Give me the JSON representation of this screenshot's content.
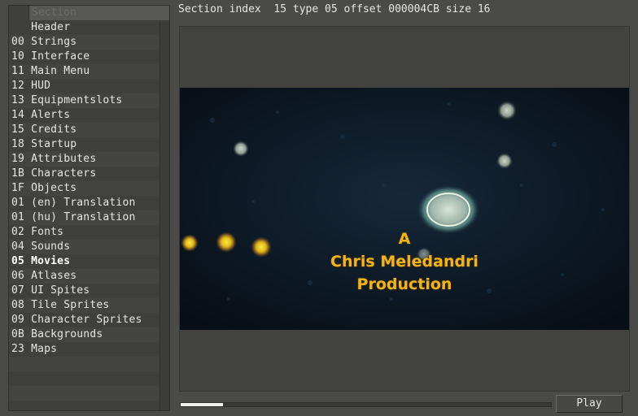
{
  "info": {
    "text": "Section index  15 type 05 offset 000004CB size 16"
  },
  "section_list": {
    "column_header": "Section",
    "selected_index": 16,
    "items": [
      {
        "label": "   Header"
      },
      {
        "label": "00 Strings"
      },
      {
        "label": "10 Interface"
      },
      {
        "label": "11 Main Menu"
      },
      {
        "label": "12 HUD"
      },
      {
        "label": "13 Equipmentslots"
      },
      {
        "label": "14 Alerts"
      },
      {
        "label": "15 Credits"
      },
      {
        "label": "18 Startup"
      },
      {
        "label": "19 Attributes"
      },
      {
        "label": "1B Characters"
      },
      {
        "label": "1F Objects"
      },
      {
        "label": "01 (en) Translation"
      },
      {
        "label": "01 (hu) Translation"
      },
      {
        "label": "02 Fonts"
      },
      {
        "label": "04 Sounds"
      },
      {
        "label": "05 Movies"
      },
      {
        "label": "06 Atlases"
      },
      {
        "label": "07 UI Spites"
      },
      {
        "label": "08 Tile Sprites"
      },
      {
        "label": "09 Character Sprites"
      },
      {
        "label": "0B Backgrounds"
      },
      {
        "label": "23 Maps"
      }
    ]
  },
  "video": {
    "credit_lines": [
      "A",
      "Chris Meledandri",
      "Production"
    ],
    "progress": 0.115
  },
  "play_button": {
    "label": "Play"
  },
  "colors": {
    "credit_text": "#f2b418",
    "frame_background": "#0b1620",
    "panel_background": "#424340"
  }
}
